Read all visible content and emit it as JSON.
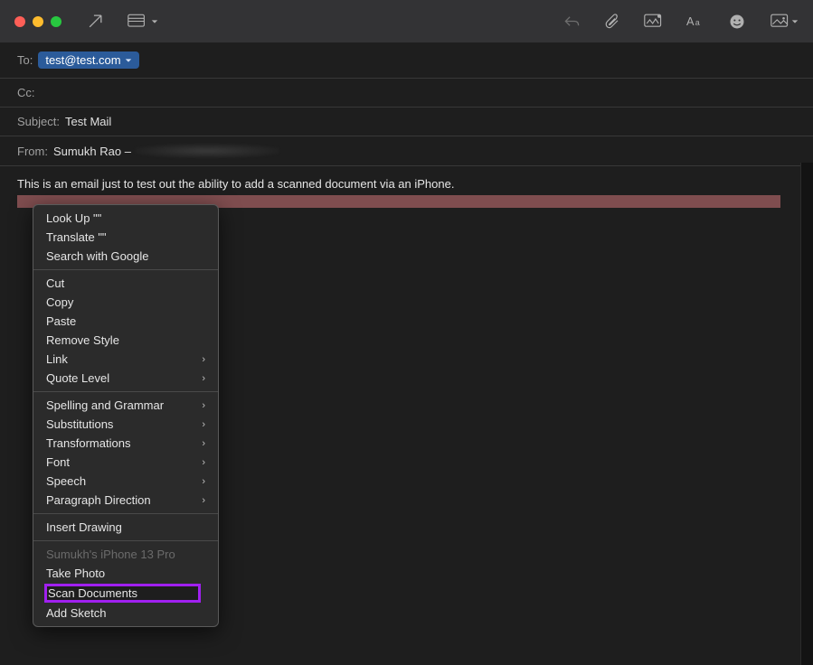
{
  "toolbar": {
    "traffic": {
      "close": "close",
      "min": "minimize",
      "max": "fullscreen"
    }
  },
  "fields": {
    "to_label": "To:",
    "to_recipient": "test@test.com",
    "cc_label": "Cc:",
    "subject_label": "Subject:",
    "subject_value": "Test Mail",
    "from_label": "From:",
    "from_name": "Sumukh Rao –"
  },
  "body": {
    "text": "This is an email just to test out the ability to add a scanned document via an iPhone."
  },
  "context_menu": {
    "group1": {
      "lookup": "Look Up \"\"",
      "translate": "Translate \"\"",
      "search": "Search with Google"
    },
    "group2": {
      "cut": "Cut",
      "copy": "Copy",
      "paste": "Paste",
      "remove_style": "Remove Style",
      "link": "Link",
      "quote_level": "Quote Level"
    },
    "group3": {
      "spelling": "Spelling and Grammar",
      "subs": "Substitutions",
      "transforms": "Transformations",
      "font": "Font",
      "speech": "Speech",
      "paragraph": "Paragraph Direction"
    },
    "group4": {
      "insert_drawing": "Insert Drawing"
    },
    "group5": {
      "device": "Sumukh's iPhone 13 Pro",
      "take_photo": "Take Photo",
      "scan_docs": "Scan Documents",
      "add_sketch": "Add Sketch"
    }
  }
}
